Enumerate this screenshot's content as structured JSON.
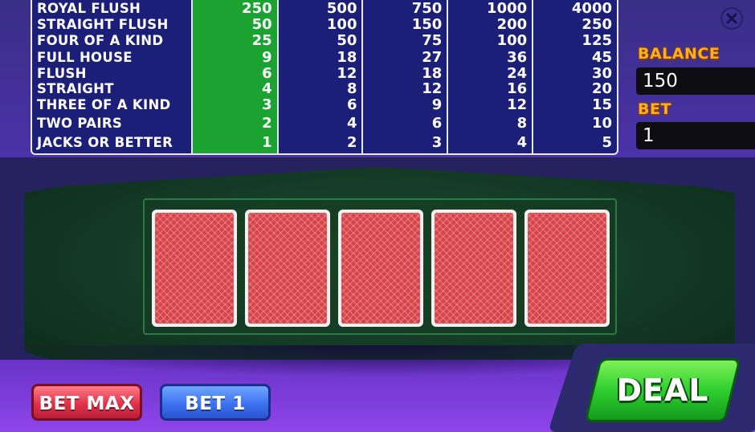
{
  "paytable": {
    "hands": [
      "ROYAL FLUSH",
      "STRAIGHT FLUSH",
      "FOUR OF A KIND",
      "FULL HOUSE",
      "FLUSH",
      "STRAIGHT",
      "THREE OF A KIND",
      "TWO PAIRS",
      "JACKS OR BETTER"
    ],
    "columns": [
      [
        "250",
        "50",
        "25",
        "9",
        "6",
        "4",
        "3",
        "2",
        "1"
      ],
      [
        "500",
        "100",
        "50",
        "18",
        "12",
        "8",
        "6",
        "4",
        "2"
      ],
      [
        "750",
        "150",
        "75",
        "27",
        "18",
        "12",
        "9",
        "6",
        "3"
      ],
      [
        "1000",
        "200",
        "100",
        "36",
        "24",
        "16",
        "12",
        "8",
        "4"
      ],
      [
        "4000",
        "250",
        "125",
        "45",
        "30",
        "20",
        "15",
        "10",
        "5"
      ]
    ],
    "highlight_color": "#1aa330"
  },
  "balance": {
    "label": "BALANCE",
    "value": "150"
  },
  "bet": {
    "label": "BET",
    "value": "1"
  },
  "cards": [
    "card-back",
    "card-back",
    "card-back",
    "card-back",
    "card-back"
  ],
  "buttons": {
    "bet_max": "BET MAX",
    "bet_one": "BET 1",
    "deal": "DEAL"
  },
  "icons": {
    "close": "close-icon"
  }
}
